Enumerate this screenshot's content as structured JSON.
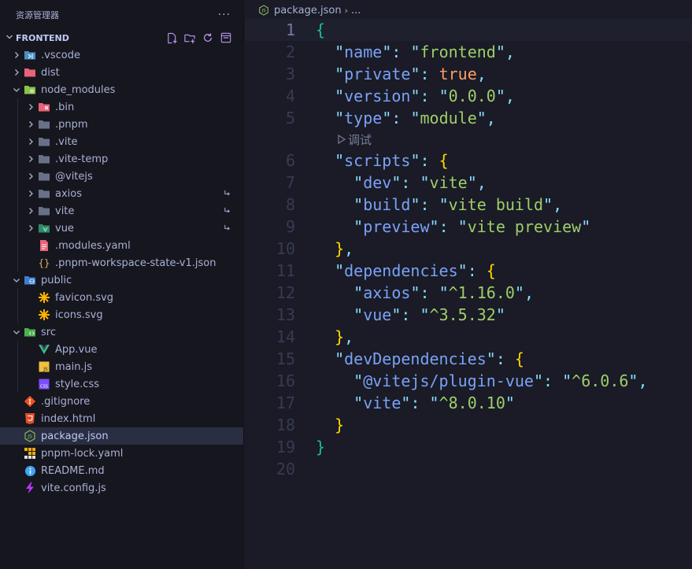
{
  "explorer": {
    "title": "资源管理器",
    "more": "···",
    "section": "FRONTEND"
  },
  "tree": [
    {
      "name": ".vscode",
      "icon": "vscode-folder-icon",
      "level": 0,
      "chevron": "right"
    },
    {
      "name": "dist",
      "icon": "dist-folder-icon",
      "level": 0,
      "chevron": "right"
    },
    {
      "name": "node_modules",
      "icon": "node-folder-icon",
      "level": 0,
      "chevron": "down"
    },
    {
      "name": ".bin",
      "icon": "bin-folder-icon",
      "level": 1,
      "chevron": "right"
    },
    {
      "name": ".pnpm",
      "icon": "folder-icon",
      "level": 1,
      "chevron": "right"
    },
    {
      "name": ".vite",
      "icon": "folder-icon",
      "level": 1,
      "chevron": "right"
    },
    {
      "name": ".vite-temp",
      "icon": "folder-icon",
      "level": 1,
      "chevron": "right"
    },
    {
      "name": "@vitejs",
      "icon": "folder-icon",
      "level": 1,
      "chevron": "right"
    },
    {
      "name": "axios",
      "icon": "folder-icon",
      "level": 1,
      "chevron": "right",
      "link": true
    },
    {
      "name": "vite",
      "icon": "folder-icon",
      "level": 1,
      "chevron": "right",
      "link": true
    },
    {
      "name": "vue",
      "icon": "vue-folder-icon",
      "level": 1,
      "chevron": "right",
      "link": true
    },
    {
      "name": ".modules.yaml",
      "icon": "yaml-icon",
      "level": 1
    },
    {
      "name": ".pnpm-workspace-state-v1.json",
      "icon": "json-braces-icon",
      "level": 1
    },
    {
      "name": "public",
      "icon": "public-folder-icon",
      "level": 0,
      "chevron": "down"
    },
    {
      "name": "favicon.svg",
      "icon": "svg-icon",
      "level": 1
    },
    {
      "name": "icons.svg",
      "icon": "svg-icon",
      "level": 1
    },
    {
      "name": "src",
      "icon": "src-folder-icon",
      "level": 0,
      "chevron": "down"
    },
    {
      "name": "App.vue",
      "icon": "vue-icon",
      "level": 1
    },
    {
      "name": "main.js",
      "icon": "js-icon",
      "level": 1
    },
    {
      "name": "style.css",
      "icon": "css-icon",
      "level": 1
    },
    {
      "name": ".gitignore",
      "icon": "git-icon",
      "level": 0
    },
    {
      "name": "index.html",
      "icon": "html-icon",
      "level": 0
    },
    {
      "name": "package.json",
      "icon": "node-json-icon",
      "level": 0,
      "selected": true
    },
    {
      "name": "pnpm-lock.yaml",
      "icon": "pnpm-icon",
      "level": 0
    },
    {
      "name": "README.md",
      "icon": "info-icon",
      "level": 0
    },
    {
      "name": "vite.config.js",
      "icon": "vite-icon",
      "level": 0
    }
  ],
  "breadcrumb": {
    "file": "package.json",
    "sep": "›",
    "rest": "..."
  },
  "codelens": "调试",
  "code": [
    {
      "n": "1",
      "tokens": [
        [
          "br0",
          "{"
        ]
      ]
    },
    {
      "n": "2",
      "tokens": [
        [
          "sp",
          "  "
        ],
        [
          "p",
          "\""
        ],
        [
          "k",
          "name"
        ],
        [
          "p",
          "\""
        ],
        [
          "p",
          ": "
        ],
        [
          "p",
          "\""
        ],
        [
          "s",
          "frontend"
        ],
        [
          "p",
          "\""
        ],
        [
          "p",
          ","
        ]
      ]
    },
    {
      "n": "3",
      "tokens": [
        [
          "sp",
          "  "
        ],
        [
          "p",
          "\""
        ],
        [
          "k",
          "private"
        ],
        [
          "p",
          "\""
        ],
        [
          "p",
          ": "
        ],
        [
          "b",
          "true"
        ],
        [
          "p",
          ","
        ]
      ]
    },
    {
      "n": "4",
      "tokens": [
        [
          "sp",
          "  "
        ],
        [
          "p",
          "\""
        ],
        [
          "k",
          "version"
        ],
        [
          "p",
          "\""
        ],
        [
          "p",
          ": "
        ],
        [
          "p",
          "\""
        ],
        [
          "s",
          "0.0.0"
        ],
        [
          "p",
          "\""
        ],
        [
          "p",
          ","
        ]
      ]
    },
    {
      "n": "5",
      "tokens": [
        [
          "sp",
          "  "
        ],
        [
          "p",
          "\""
        ],
        [
          "k",
          "type"
        ],
        [
          "p",
          "\""
        ],
        [
          "p",
          ": "
        ],
        [
          "p",
          "\""
        ],
        [
          "s",
          "module"
        ],
        [
          "p",
          "\""
        ],
        [
          "p",
          ","
        ]
      ]
    },
    {
      "n": "",
      "lens": true
    },
    {
      "n": "6",
      "tokens": [
        [
          "sp",
          "  "
        ],
        [
          "p",
          "\""
        ],
        [
          "k",
          "scripts"
        ],
        [
          "p",
          "\""
        ],
        [
          "p",
          ": "
        ],
        [
          "br1",
          "{"
        ]
      ]
    },
    {
      "n": "7",
      "tokens": [
        [
          "sp",
          "    "
        ],
        [
          "p",
          "\""
        ],
        [
          "k",
          "dev"
        ],
        [
          "p",
          "\""
        ],
        [
          "p",
          ": "
        ],
        [
          "p",
          "\""
        ],
        [
          "s",
          "vite"
        ],
        [
          "p",
          "\""
        ],
        [
          "p",
          ","
        ]
      ]
    },
    {
      "n": "8",
      "tokens": [
        [
          "sp",
          "    "
        ],
        [
          "p",
          "\""
        ],
        [
          "k",
          "build"
        ],
        [
          "p",
          "\""
        ],
        [
          "p",
          ": "
        ],
        [
          "p",
          "\""
        ],
        [
          "s",
          "vite build"
        ],
        [
          "p",
          "\""
        ],
        [
          "p",
          ","
        ]
      ]
    },
    {
      "n": "9",
      "tokens": [
        [
          "sp",
          "    "
        ],
        [
          "p",
          "\""
        ],
        [
          "k",
          "preview"
        ],
        [
          "p",
          "\""
        ],
        [
          "p",
          ": "
        ],
        [
          "p",
          "\""
        ],
        [
          "s",
          "vite preview"
        ],
        [
          "p",
          "\""
        ]
      ]
    },
    {
      "n": "10",
      "tokens": [
        [
          "sp",
          "  "
        ],
        [
          "br1",
          "}"
        ],
        [
          "p",
          ","
        ]
      ]
    },
    {
      "n": "11",
      "tokens": [
        [
          "sp",
          "  "
        ],
        [
          "p",
          "\""
        ],
        [
          "k",
          "dependencies"
        ],
        [
          "p",
          "\""
        ],
        [
          "p",
          ": "
        ],
        [
          "br1",
          "{"
        ]
      ]
    },
    {
      "n": "12",
      "tokens": [
        [
          "sp",
          "    "
        ],
        [
          "p",
          "\""
        ],
        [
          "k",
          "axios"
        ],
        [
          "p",
          "\""
        ],
        [
          "p",
          ": "
        ],
        [
          "p",
          "\""
        ],
        [
          "s",
          "^1.16.0"
        ],
        [
          "p",
          "\""
        ],
        [
          "p",
          ","
        ]
      ]
    },
    {
      "n": "13",
      "tokens": [
        [
          "sp",
          "    "
        ],
        [
          "p",
          "\""
        ],
        [
          "k",
          "vue"
        ],
        [
          "p",
          "\""
        ],
        [
          "p",
          ": "
        ],
        [
          "p",
          "\""
        ],
        [
          "s",
          "^3.5.32"
        ],
        [
          "p",
          "\""
        ]
      ]
    },
    {
      "n": "14",
      "tokens": [
        [
          "sp",
          "  "
        ],
        [
          "br1",
          "}"
        ],
        [
          "p",
          ","
        ]
      ]
    },
    {
      "n": "15",
      "tokens": [
        [
          "sp",
          "  "
        ],
        [
          "p",
          "\""
        ],
        [
          "k",
          "devDependencies"
        ],
        [
          "p",
          "\""
        ],
        [
          "p",
          ": "
        ],
        [
          "br1",
          "{"
        ]
      ]
    },
    {
      "n": "16",
      "tokens": [
        [
          "sp",
          "    "
        ],
        [
          "p",
          "\""
        ],
        [
          "k",
          "@vitejs/plugin-vue"
        ],
        [
          "p",
          "\""
        ],
        [
          "p",
          ": "
        ],
        [
          "p",
          "\""
        ],
        [
          "s",
          "^6.0.6"
        ],
        [
          "p",
          "\""
        ],
        [
          "p",
          ","
        ]
      ]
    },
    {
      "n": "17",
      "tokens": [
        [
          "sp",
          "    "
        ],
        [
          "p",
          "\""
        ],
        [
          "k",
          "vite"
        ],
        [
          "p",
          "\""
        ],
        [
          "p",
          ": "
        ],
        [
          "p",
          "\""
        ],
        [
          "s",
          "^8.0.10"
        ],
        [
          "p",
          "\""
        ]
      ]
    },
    {
      "n": "18",
      "tokens": [
        [
          "sp",
          "  "
        ],
        [
          "br1",
          "}"
        ]
      ]
    },
    {
      "n": "19",
      "tokens": [
        [
          "br0",
          "}"
        ]
      ]
    },
    {
      "n": "20",
      "tokens": []
    }
  ],
  "colors": {
    "sidebar_bg": "#16161e",
    "editor_bg": "#1a1b26",
    "selection": "#292e42",
    "key": "#7aa2f7",
    "string": "#9ece6a",
    "boolean": "#ff9e64",
    "bracket_outer": "#1abc9c",
    "bracket_inner": "#ffd700"
  }
}
